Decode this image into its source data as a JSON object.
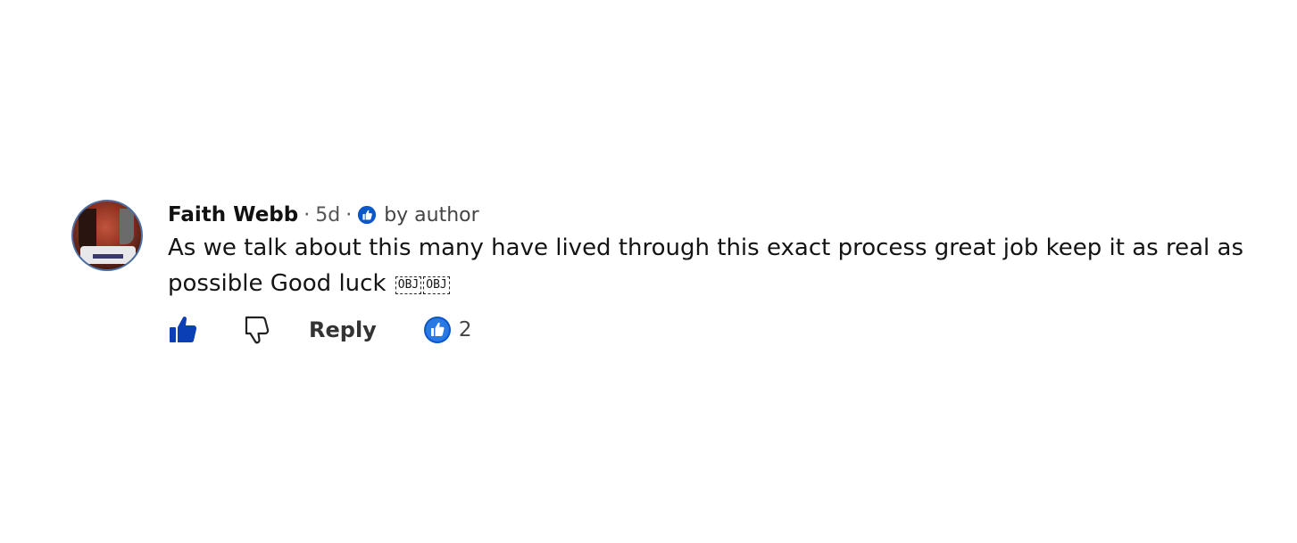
{
  "comment": {
    "author": "Faith Webb",
    "separator": "·",
    "age": "5d",
    "liked_by_label": "by author",
    "text": "As we talk about this many have lived through this exact process great job keep it as real as possible Good luck",
    "emoji_placeholders": [
      "OBJ",
      "OBJ"
    ],
    "actions": {
      "reply_label": "Reply",
      "like_count": "2"
    }
  },
  "icons": {
    "avatar": "user-avatar",
    "liked_badge": "thumbs-up-badge-icon",
    "like": "thumbs-up-icon",
    "dislike": "thumbs-down-icon",
    "like_count": "thumbs-up-circle-icon"
  },
  "colors": {
    "accent": "#0a57c9",
    "text": "#141414",
    "muted": "#555555"
  }
}
